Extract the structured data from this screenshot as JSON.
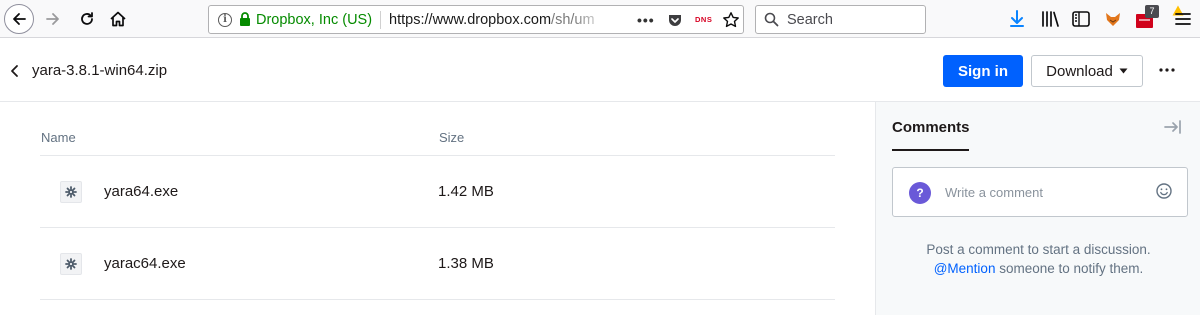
{
  "browser": {
    "url_ev_label": "Dropbox, Inc (US)",
    "url_host": "https://www.dropbox.com",
    "url_path": "/sh/um",
    "dns_label": "DNS",
    "search_placeholder": "Search",
    "notification_badge": "7",
    "icons": [
      "back-icon",
      "forward-icon",
      "reload-icon",
      "home-icon",
      "info-icon",
      "lock-icon",
      "page-actions-icon",
      "pocket-icon",
      "star-icon",
      "search-icon",
      "download-arrow-icon",
      "library-icon",
      "sidebar-icon",
      "extension-fox-icon",
      "extension-red-icon",
      "warning-icon",
      "hamburger-menu-icon"
    ],
    "colors": {
      "ev_green": "#058b00",
      "dns_red": "#d70022"
    }
  },
  "header": {
    "file_title": "yara-3.8.1-win64.zip",
    "signin_label": "Sign in",
    "download_label": "Download",
    "colors": {
      "primary": "#0061fe"
    }
  },
  "file_list": {
    "col_name": "Name",
    "col_size": "Size",
    "rows": [
      {
        "name": "yara64.exe",
        "size": "1.42 MB",
        "icon": "gear-file-icon"
      },
      {
        "name": "yarac64.exe",
        "size": "1.38 MB",
        "icon": "gear-file-icon"
      }
    ]
  },
  "comments": {
    "title": "Comments",
    "avatar_glyph": "?",
    "placeholder": "Write a comment",
    "empty_line1": "Post a comment to start a discussion.",
    "mention": "@Mention",
    "empty_line2_rest": " someone to notify them.",
    "colors": {
      "avatar": "#6a59d8"
    }
  }
}
